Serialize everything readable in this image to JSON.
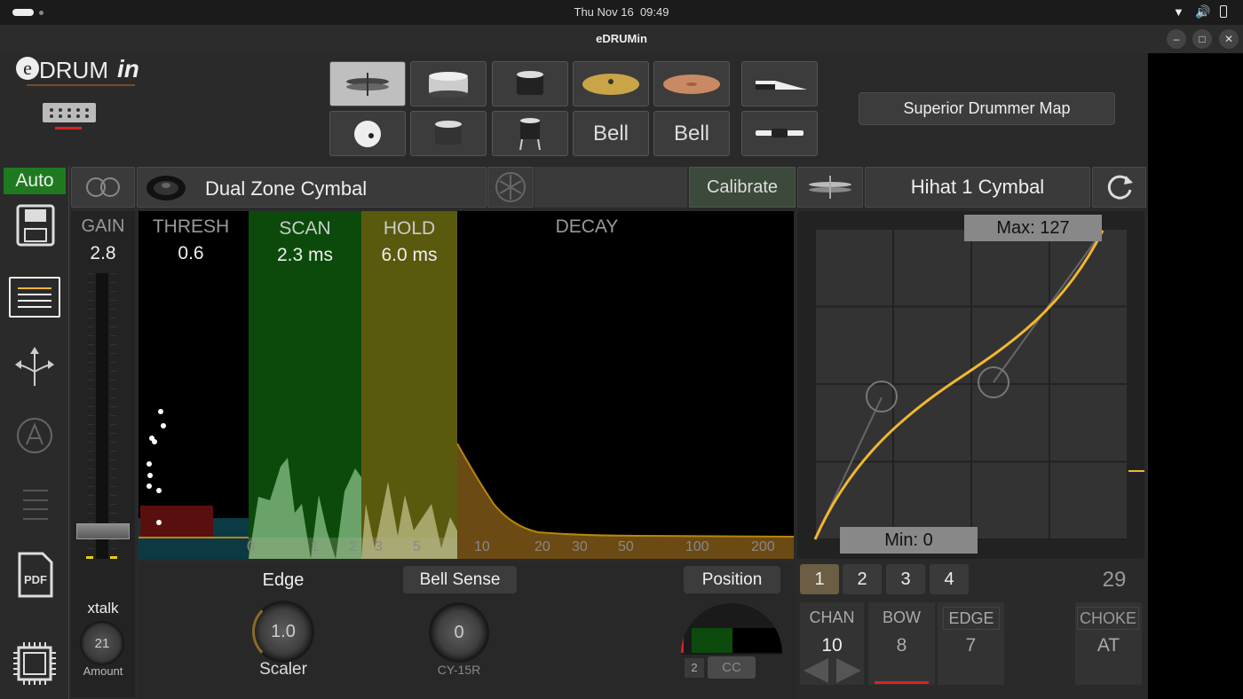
{
  "system": {
    "date": "Thu Nov 16",
    "time": "09:49"
  },
  "window": {
    "title": "eDRUMin"
  },
  "logo": {
    "e": "e",
    "drum": "DRUM",
    "in": "in"
  },
  "pads": {
    "row2": {
      "bell1": "Bell",
      "bell2": "Bell"
    },
    "map_button": "Superior Drummer Map"
  },
  "sidebar": {
    "auto_label": "Auto"
  },
  "header": {
    "zone_type": "Dual Zone Cymbal",
    "calibrate": "Calibrate",
    "instrument": "Hihat 1 Cymbal"
  },
  "gain": {
    "label": "GAIN",
    "value": "2.8"
  },
  "thresh": {
    "label": "THRESH",
    "value": "0.6"
  },
  "scan": {
    "label": "SCAN",
    "value": "2.3 ms"
  },
  "hold": {
    "label": "HOLD",
    "value": "6.0 ms"
  },
  "decay": {
    "label": "DECAY"
  },
  "time_axis": [
    "0",
    "1",
    "2",
    "3",
    "5",
    "10",
    "20",
    "30",
    "50",
    "100",
    "200"
  ],
  "curve": {
    "max_label": "Max: 127",
    "min_label": "Min: 0"
  },
  "xtalk": {
    "label": "xtalk",
    "value": "21",
    "sub": "Amount"
  },
  "edge": {
    "label": "Edge",
    "value": "1.0",
    "sub": "Scaler"
  },
  "bell": {
    "button": "Bell Sense",
    "value": "0",
    "sub": "CY-15R"
  },
  "position": {
    "button": "Position",
    "num": "2",
    "cc": "CC"
  },
  "channel_tabs": [
    "1",
    "2",
    "3",
    "4"
  ],
  "velocity_readout": "29",
  "midi": {
    "chan_label": "CHAN",
    "chan_value": "10",
    "bow_label": "BOW",
    "bow_value": "8",
    "edge_label": "EDGE",
    "edge_value": "7",
    "choke_label": "CHOKE",
    "choke_value": "AT"
  },
  "colors": {
    "accent": "#f2b632",
    "scan": "#0b4a0b",
    "hold": "#5a5a0e",
    "auto": "#1f7a1f"
  }
}
